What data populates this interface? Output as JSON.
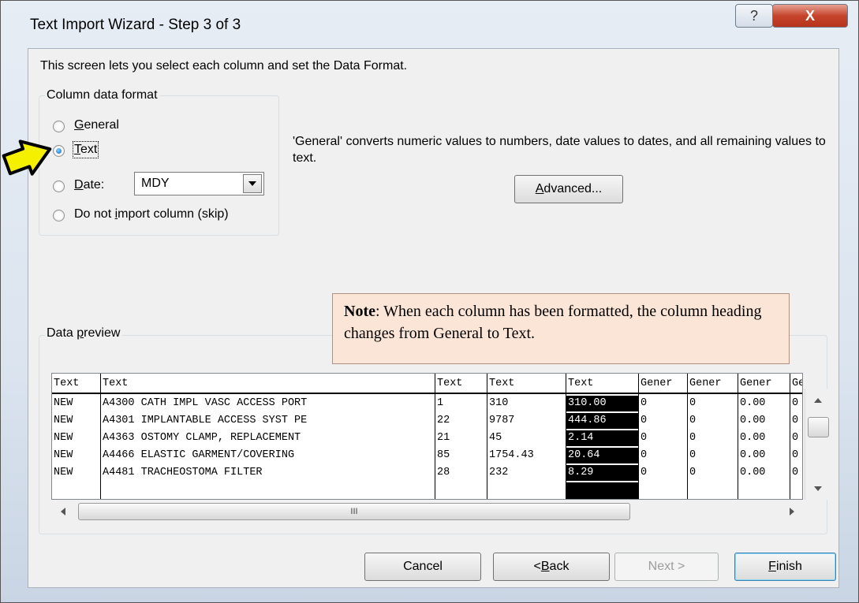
{
  "window": {
    "title": "Text Import Wizard - Step 3 of 3",
    "help_label": "?",
    "close_label": "X"
  },
  "description": "This screen lets you select each column and set the Data Format.",
  "column_data_format": {
    "legend": "Column data format",
    "options": [
      {
        "label": "General",
        "selected": false
      },
      {
        "label": "Text",
        "selected": true
      },
      {
        "label": "Date:",
        "selected": false
      },
      {
        "label": "Do not import column (skip)",
        "selected": false
      }
    ],
    "date_format": "MDY"
  },
  "info_text": "'General' converts numeric values to numbers, date values to dates, and all remaining values to text.",
  "advanced_label": "Advanced...",
  "note": {
    "bold": "Note",
    "text": ": When each column has been formatted, the column heading changes from General to Text."
  },
  "data_preview": {
    "legend": "Data preview",
    "headers": [
      "Text",
      "Text",
      "Text",
      "Text",
      "Text",
      "Gener",
      "Gener",
      "Gener",
      "Ge"
    ],
    "rows": [
      [
        "NEW",
        "A4300 CATH IMPL VASC ACCESS PORT",
        "1",
        "310",
        "310.00",
        "0",
        "0",
        "0.00",
        "0"
      ],
      [
        "NEW",
        "A4301 IMPLANTABLE ACCESS SYST PE",
        "22",
        "9787",
        "444.86",
        "0",
        "0",
        "0.00",
        "0"
      ],
      [
        "NEW",
        "A4363 OSTOMY CLAMP, REPLACEMENT",
        "21",
        "45",
        "2.14",
        "0",
        "0",
        "0.00",
        "0"
      ],
      [
        "NEW",
        "A4466 ELASTIC GARMENT/COVERING",
        "85",
        "1754.43",
        "20.64",
        "0",
        "0",
        "0.00",
        "0"
      ],
      [
        "NEW",
        "A4481 TRACHEOSTOMA FILTER",
        "28",
        "232",
        "8.29",
        "0",
        "0",
        "0.00",
        "0"
      ]
    ],
    "hscroll_mark": "III"
  },
  "buttons": {
    "cancel": "Cancel",
    "back": "< Back",
    "next": "Next >",
    "finish": "Finish"
  },
  "colors": {
    "note_bg": "#fbe5d6",
    "pointer_arrow": "#f5f000",
    "close_red": "#c5442b"
  }
}
